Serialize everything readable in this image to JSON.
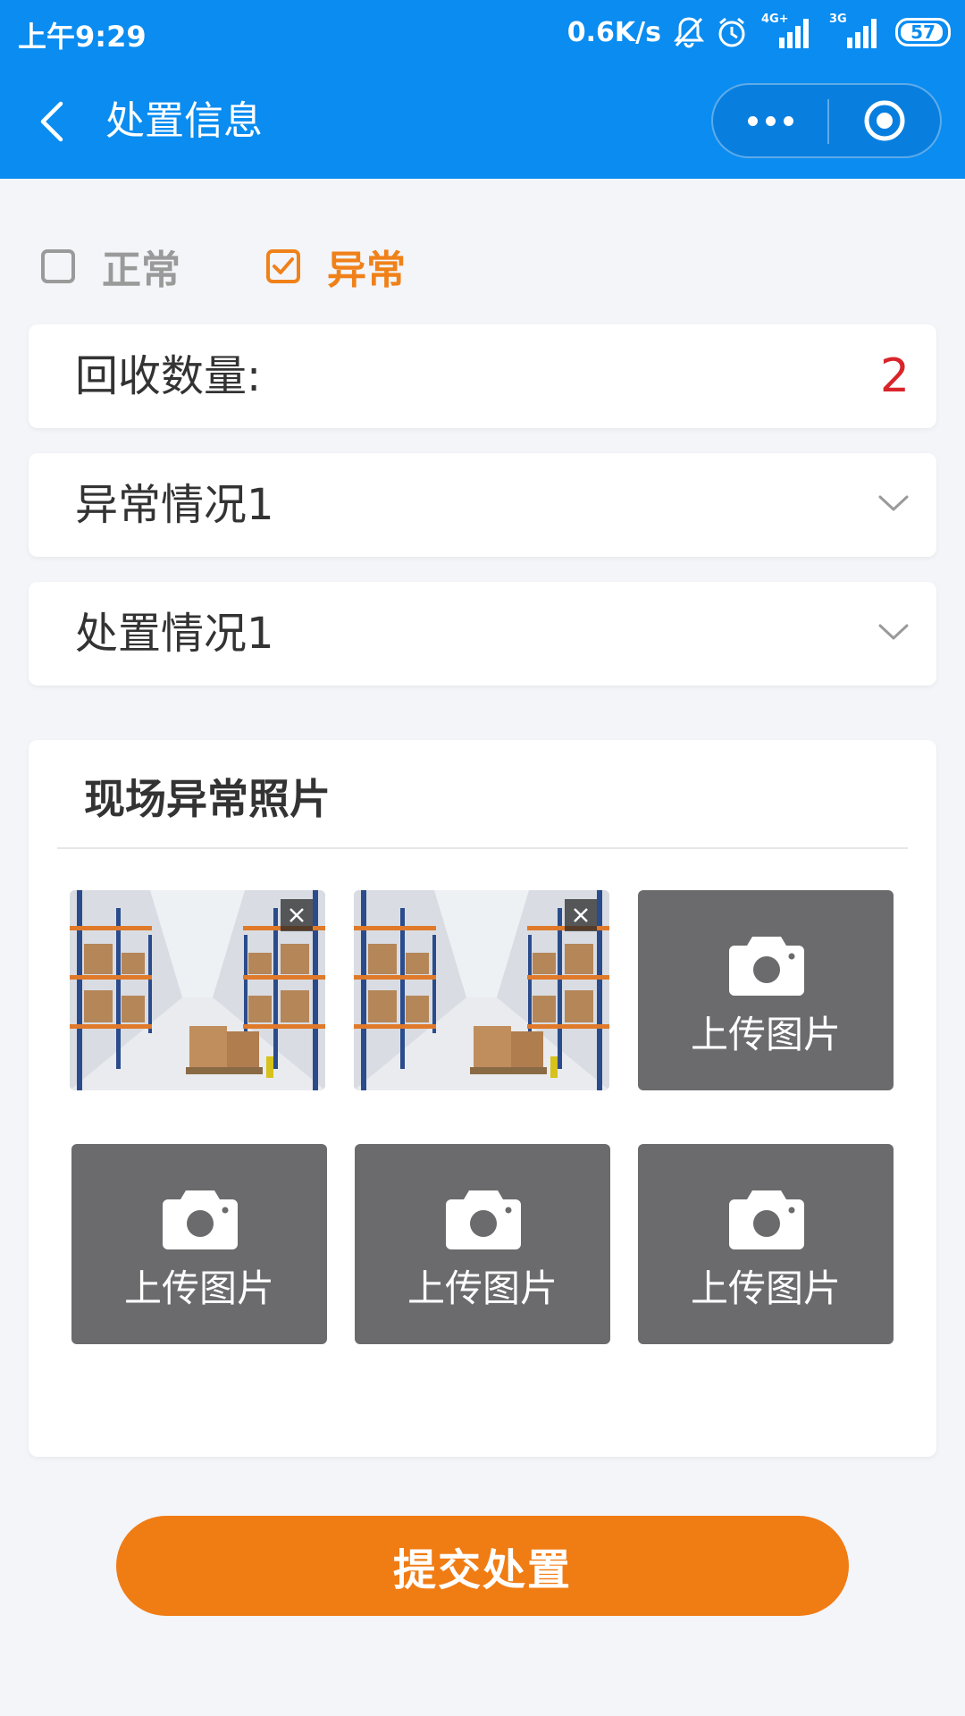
{
  "status_bar": {
    "time": "上午9:29",
    "net_speed": "0.6K/s",
    "net1": "4G+",
    "net2": "3G",
    "battery": "57",
    "icons": [
      "bell-off-icon",
      "alarm-icon",
      "signal-icon",
      "signal-icon",
      "battery-icon"
    ]
  },
  "nav": {
    "title": "处置信息",
    "back_icon": "chevron-left-icon",
    "more_icon": "more-dots-icon",
    "close_icon": "target-circle-icon"
  },
  "status_options": {
    "normal_label": "正常",
    "normal_checked": false,
    "abnormal_label": "异常",
    "abnormal_checked": true
  },
  "recycle": {
    "label": "回收数量:",
    "value": "2"
  },
  "abnormal_select": {
    "value": "异常情况1"
  },
  "disposal_select": {
    "value": "处置情况1"
  },
  "photos": {
    "title": "现场异常照片",
    "upload_label": "上传图片",
    "uploaded_count": 2,
    "upload_slots": 4
  },
  "submit_label": "提交处置",
  "colors": {
    "header_blue": "#0a8cf0",
    "accent_orange": "#f08119",
    "value_red": "#d9252a",
    "upload_gray": "#6b6b6d"
  }
}
